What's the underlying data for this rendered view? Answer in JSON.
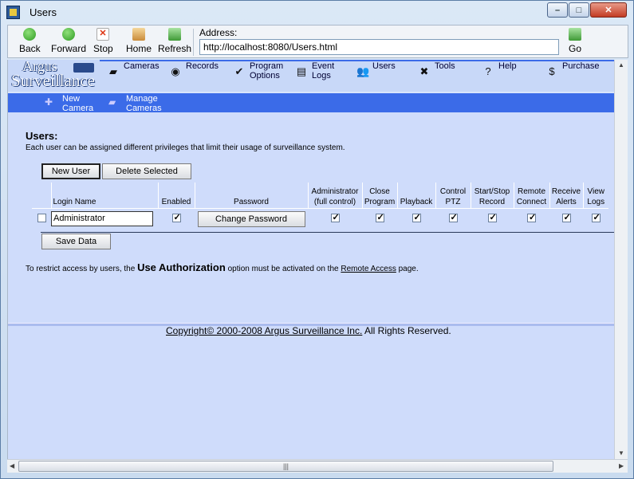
{
  "window": {
    "title": "Users",
    "min_label": "–",
    "max_label": "□",
    "close_label": "✕"
  },
  "toolbar": {
    "back": "Back",
    "forward": "Forward",
    "stop": "Stop",
    "home": "Home",
    "refresh": "Refresh",
    "address_label": "Address:",
    "address_value": "http://localhost:8080/Users.html",
    "go": "Go"
  },
  "logo": {
    "line1": "Argus",
    "line2": "Surveillance"
  },
  "nav": {
    "items": [
      {
        "label1": "Cameras",
        "label2": "",
        "icon": "camera-icon"
      },
      {
        "label1": "Records",
        "label2": "",
        "icon": "disc-icon"
      },
      {
        "label1": "Program",
        "label2": "Options",
        "icon": "check-icon"
      },
      {
        "label1": "Event",
        "label2": "Logs",
        "icon": "document-icon"
      },
      {
        "label1": "Users",
        "label2": "",
        "icon": "users-icon"
      },
      {
        "label1": "Tools",
        "label2": "",
        "icon": "tools-icon"
      },
      {
        "label1": "Help",
        "label2": "",
        "icon": "question-icon"
      },
      {
        "label1": "Purchase",
        "label2": "",
        "icon": "dollar-icon"
      }
    ]
  },
  "subnav": {
    "new_camera_1": "New",
    "new_camera_2": "Camera",
    "manage_1": "Manage",
    "manage_2": "Cameras"
  },
  "page": {
    "heading": "Users:",
    "description": "Each user can be assigned different privileges that limit their usage of surveillance system.",
    "new_user": "New User",
    "delete_selected": "Delete Selected",
    "save_data": "Save Data",
    "note_prefix": "To restrict access by users, the ",
    "note_bold": "Use Authorization",
    "note_middle": " option must be activated on the ",
    "note_link": "Remote Access",
    "note_suffix": " page.",
    "copyright_link": "Copyright© 2000-2008 Argus Surveillance Inc.",
    "copyright_rest": " All Rights Reserved."
  },
  "table": {
    "headers": {
      "login": "Login Name",
      "enabled": "Enabled",
      "password": "Password",
      "admin1": "Administrator",
      "admin2": "(full control)",
      "close1": "Close",
      "close2": "Program",
      "playback": "Playback",
      "ptz1": "Control",
      "ptz2": "PTZ",
      "record1": "Start/Stop",
      "record2": "Record",
      "remote1": "Remote",
      "remote2": "Connect",
      "alerts1": "Receive",
      "alerts2": "Alerts",
      "logs1": "View",
      "logs2": "Logs"
    },
    "rows": [
      {
        "login": "Administrator",
        "change_password": "Change Password"
      }
    ]
  },
  "scroll": {
    "grip": "|||"
  }
}
